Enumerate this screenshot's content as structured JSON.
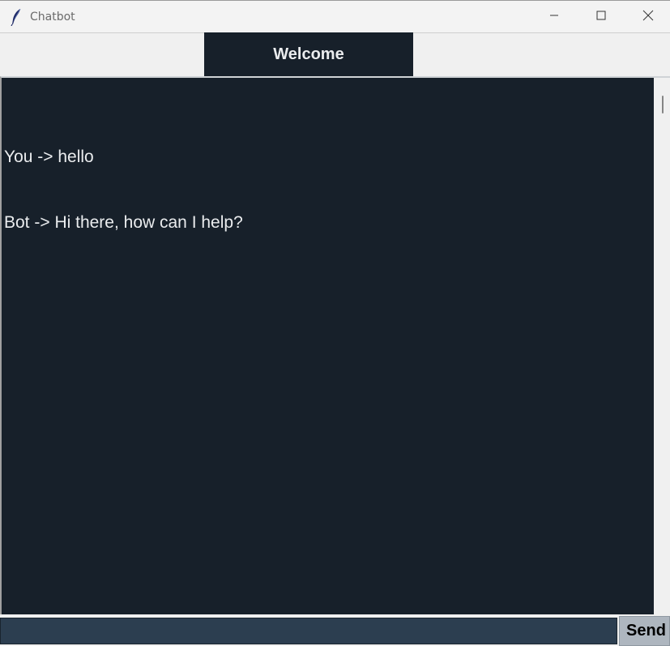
{
  "window": {
    "title": "Chatbot",
    "icon": "feather-icon",
    "controls": [
      "minimize-icon",
      "maximize-icon",
      "close-icon"
    ]
  },
  "header": {
    "label": "Welcome"
  },
  "chat": {
    "messages": [
      "You -> hello",
      "Bot -> Hi there, how can I help?"
    ]
  },
  "input": {
    "value": "",
    "placeholder": ""
  },
  "send_button": {
    "label": "Send"
  },
  "colors": {
    "background": "#17202a",
    "text": "#eaecee",
    "entry": "#2c3e50",
    "button": "#aeb6bf"
  }
}
